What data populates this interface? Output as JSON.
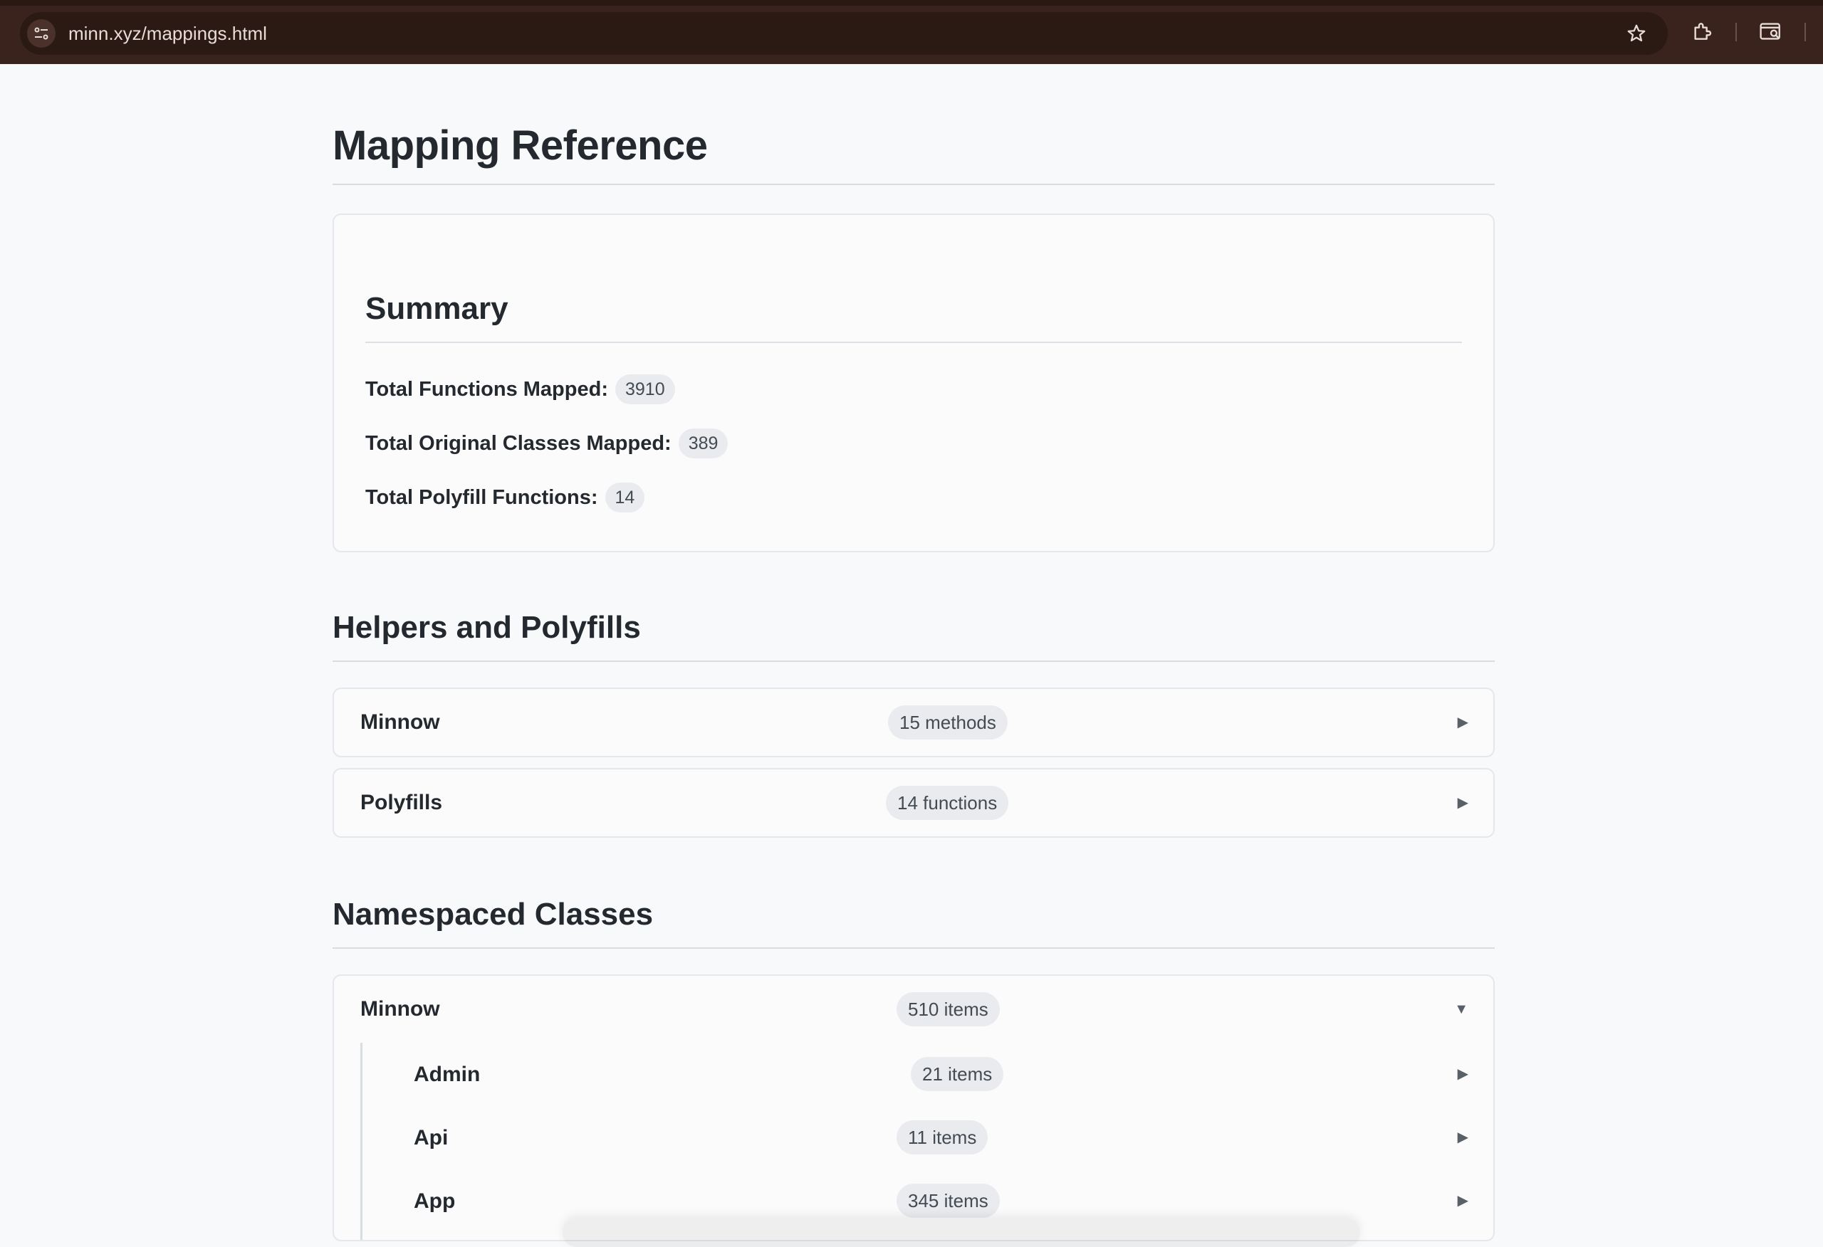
{
  "browser": {
    "url": "minn.xyz/mappings.html"
  },
  "page": {
    "title": "Mapping Reference"
  },
  "summary": {
    "title": "Summary",
    "stats": [
      {
        "label": "Total Functions Mapped:",
        "value": "3910"
      },
      {
        "label": "Total Original Classes Mapped:",
        "value": "389"
      },
      {
        "label": "Total Polyfill Functions:",
        "value": "14"
      }
    ]
  },
  "helpers": {
    "title": "Helpers and Polyfills",
    "items": [
      {
        "name": "Minnow",
        "count": "15 methods",
        "arrow": "▶"
      },
      {
        "name": "Polyfills",
        "count": "14 functions",
        "arrow": "▶"
      }
    ]
  },
  "namespaced": {
    "title": "Namespaced Classes",
    "group": {
      "name": "Minnow",
      "count": "510 items",
      "arrow": "▼"
    },
    "children": [
      {
        "name": "Admin",
        "count": "21 items",
        "arrow": "▶"
      },
      {
        "name": "Api",
        "count": "11 items",
        "arrow": "▶"
      },
      {
        "name": "App",
        "count": "345 items",
        "arrow": "▶"
      }
    ]
  },
  "icons": {
    "site_info": "tune-icon",
    "bookmark": "star-icon",
    "extensions": "puzzle-icon",
    "tab_search": "tab-search-icon"
  }
}
